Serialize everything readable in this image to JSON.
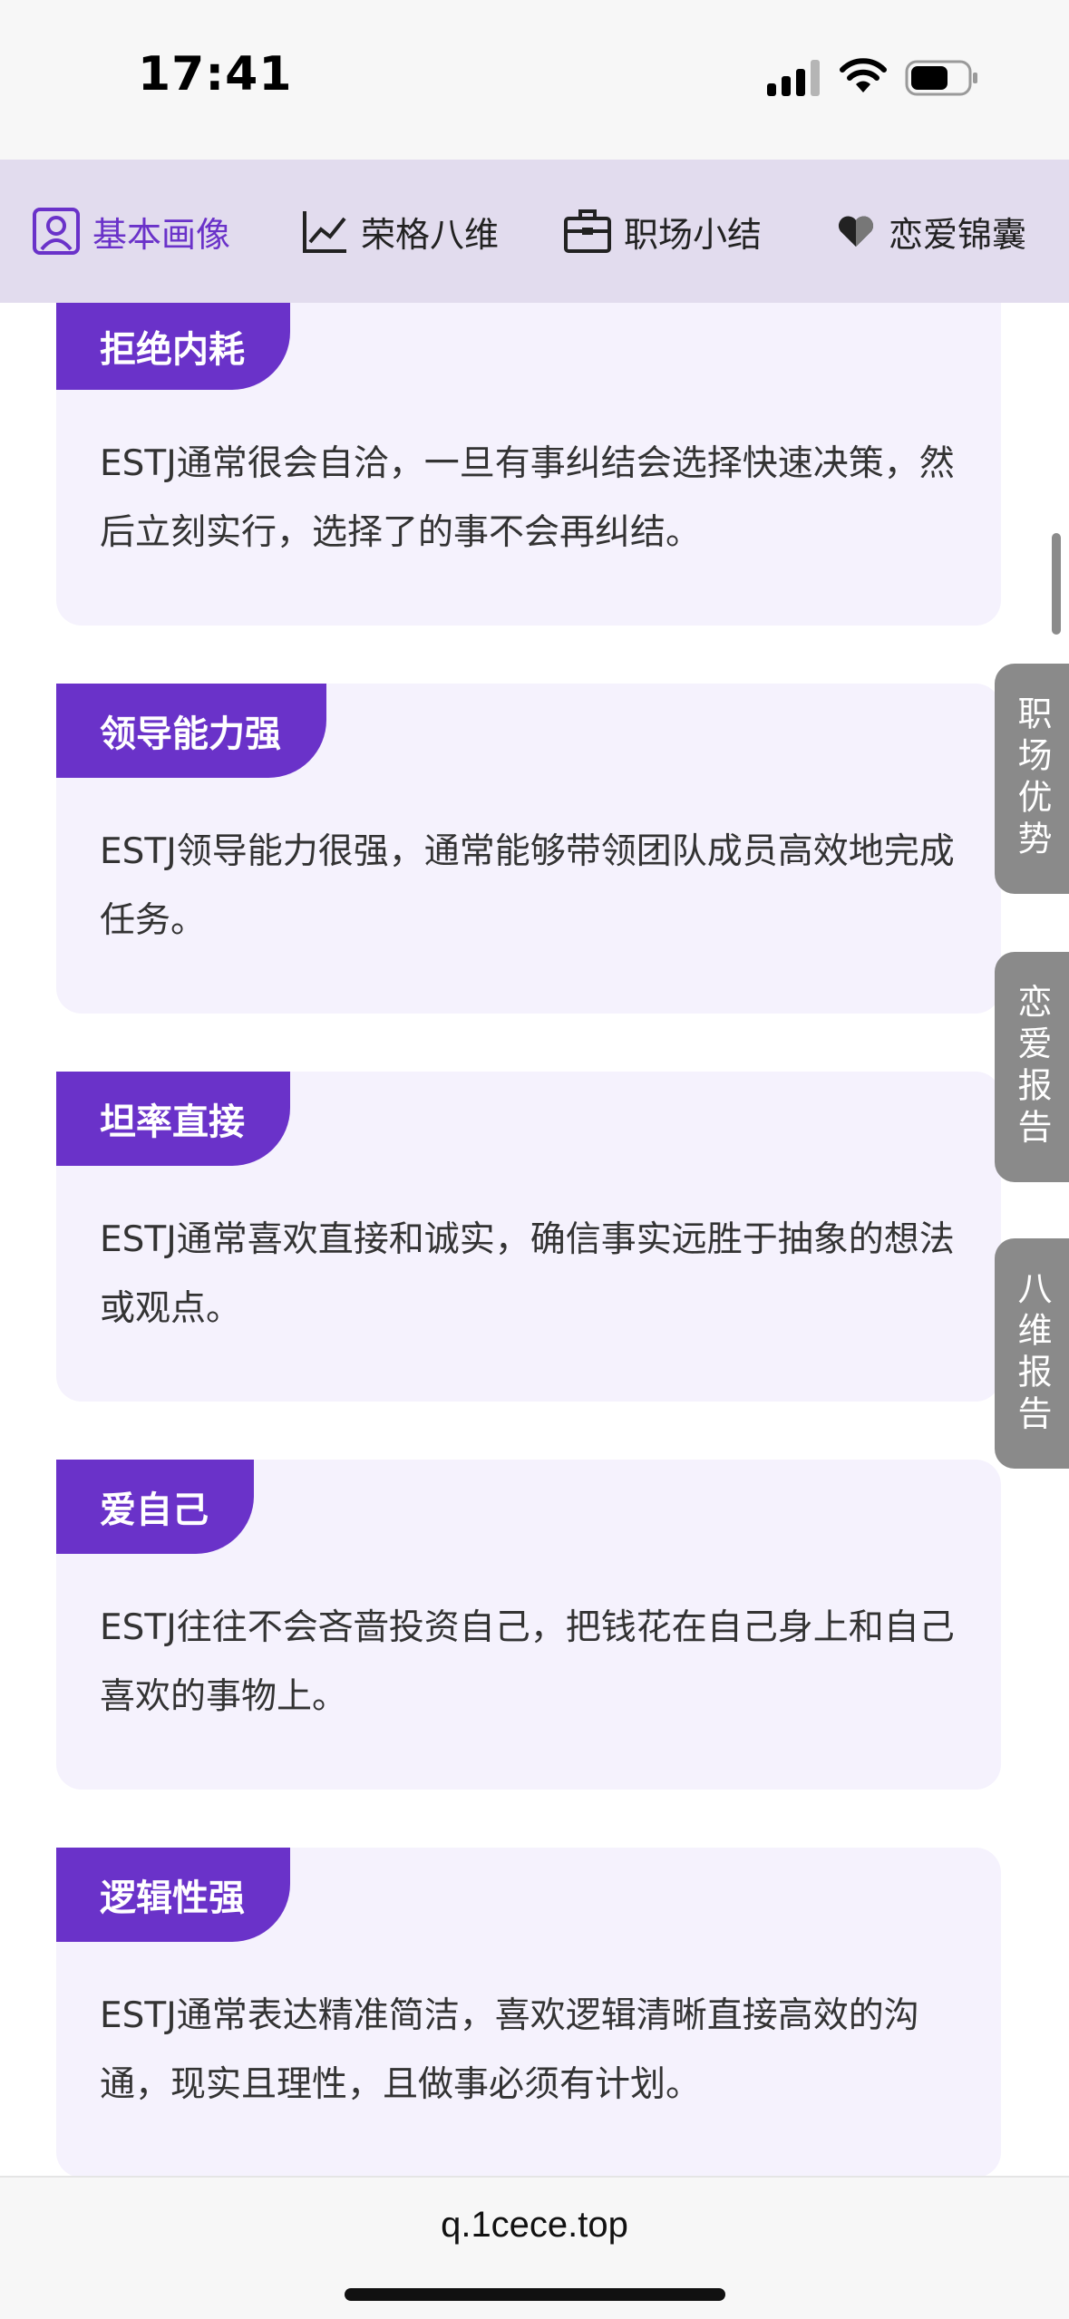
{
  "status_bar": {
    "time": "17:41"
  },
  "tabs": [
    {
      "label": "基本画像",
      "icon": "person-icon",
      "active": true
    },
    {
      "label": "荣格八维",
      "icon": "line-chart-icon",
      "active": false
    },
    {
      "label": "职场小结",
      "icon": "briefcase-icon",
      "active": false
    },
    {
      "label": "恋爱锦囊",
      "icon": "heart-icon",
      "active": false
    }
  ],
  "cards": [
    {
      "tag": "拒绝内耗",
      "text": "ESTJ通常很会自洽，一旦有事纠结会选择快速决策，然后立刻实行，选择了的事不会再纠结。"
    },
    {
      "tag": "领导能力强",
      "text": "ESTJ领导能力很强，通常能够带领团队成员高效地完成任务。"
    },
    {
      "tag": "坦率直接",
      "text": "ESTJ通常喜欢直接和诚实，确信事实远胜于抽象的想法或观点。"
    },
    {
      "tag": "爱自己",
      "text": "ESTJ往往不会吝啬投资自己，把钱花在自己身上和自己喜欢的事物上。"
    },
    {
      "tag": "逻辑性强",
      "text": "ESTJ通常表达精准简洁，喜欢逻辑清晰直接高效的沟通，现实且理性，且做事必须有计划。"
    }
  ],
  "side_buttons": [
    {
      "label": "职场优势"
    },
    {
      "label": "恋爱报告"
    },
    {
      "label": "八维报告"
    }
  ],
  "url_bar": {
    "url": "q.1cece.top"
  },
  "colors": {
    "accent": "#6a32c9",
    "tab_bar_bg": "#e2dcee",
    "card_bg": "#f5f2fd",
    "side_button_bg": "#8a8a8a"
  }
}
